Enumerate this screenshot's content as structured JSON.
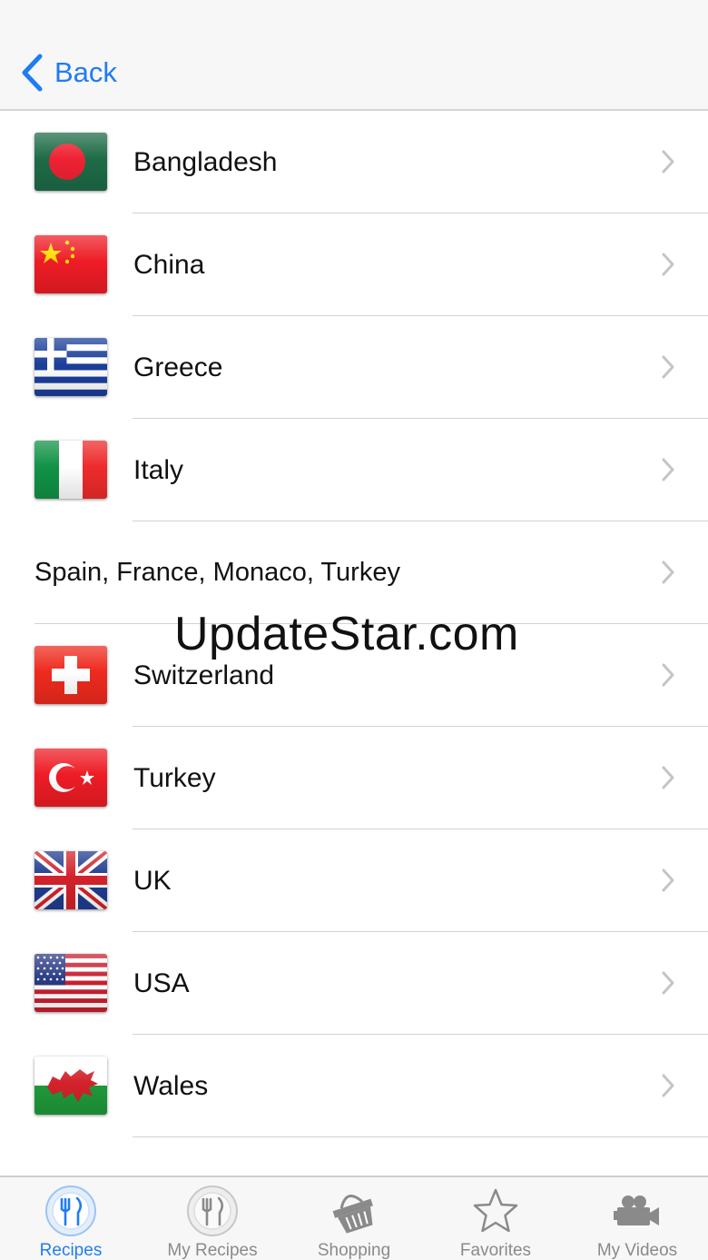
{
  "navbar": {
    "back_label": "Back",
    "accent": "#1f7cf2"
  },
  "list": {
    "items": [
      {
        "label": "Bangladesh",
        "flag": "bangladesh-flag"
      },
      {
        "label": "China",
        "flag": "china-flag"
      },
      {
        "label": "Greece",
        "flag": "greece-flag"
      },
      {
        "label": "Italy",
        "flag": "italy-flag"
      },
      {
        "label": "Spain, France, Monaco, Turkey",
        "flag": ""
      },
      {
        "label": "Switzerland",
        "flag": "switzerland-flag"
      },
      {
        "label": "Turkey",
        "flag": "turkey-flag"
      },
      {
        "label": "UK",
        "flag": "uk-flag"
      },
      {
        "label": "USA",
        "flag": "usa-flag"
      },
      {
        "label": "Wales",
        "flag": "wales-flag"
      }
    ]
  },
  "watermark": "UpdateStar.com",
  "tabbar": {
    "tabs": [
      {
        "label": "Recipes",
        "icon": "fork-knife-icon",
        "active": true
      },
      {
        "label": "My Recipes",
        "icon": "fork-knife-icon",
        "active": false
      },
      {
        "label": "Shopping",
        "icon": "shopping-basket-icon",
        "active": false
      },
      {
        "label": "Favorites",
        "icon": "star-icon",
        "active": false
      },
      {
        "label": "My Videos",
        "icon": "video-camera-icon",
        "active": false
      }
    ]
  }
}
